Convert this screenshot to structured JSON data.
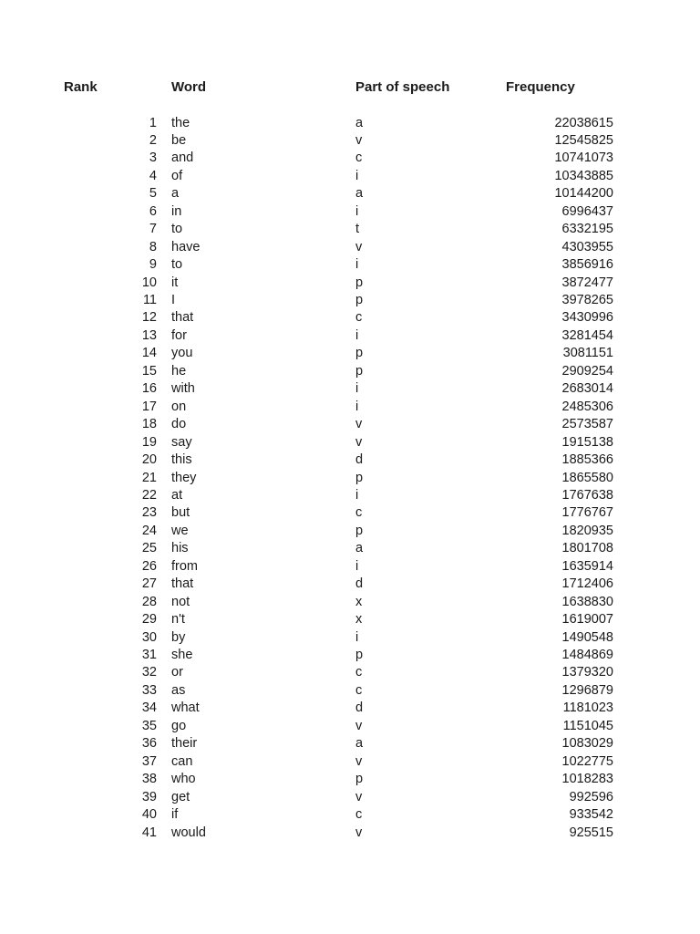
{
  "headers": {
    "rank": "Rank",
    "word": "Word",
    "pos": "Part of speech",
    "frequency": "Frequency"
  },
  "rows": [
    [
      "1",
      "the",
      "a",
      "22038615"
    ],
    [
      "2",
      "be",
      "v",
      "12545825"
    ],
    [
      "3",
      "and",
      "c",
      "10741073"
    ],
    [
      "4",
      "of",
      "i",
      "10343885"
    ],
    [
      "5",
      "a",
      "a",
      "10144200"
    ],
    [
      "6",
      "in",
      "i",
      "6996437"
    ],
    [
      "7",
      "to",
      "t",
      "6332195"
    ],
    [
      "8",
      "have",
      "v",
      "4303955"
    ],
    [
      "9",
      "to",
      "i",
      "3856916"
    ],
    [
      "10",
      "it",
      "p",
      "3872477"
    ],
    [
      "11",
      "I",
      "p",
      "3978265"
    ],
    [
      "12",
      "that",
      "c",
      "3430996"
    ],
    [
      "13",
      "for",
      "i",
      "3281454"
    ],
    [
      "14",
      "you",
      "p",
      "3081151"
    ],
    [
      "15",
      "he",
      "p",
      "2909254"
    ],
    [
      "16",
      "with",
      "i",
      "2683014"
    ],
    [
      "17",
      "on",
      "i",
      "2485306"
    ],
    [
      "18",
      "do",
      "v",
      "2573587"
    ],
    [
      "19",
      "say",
      "v",
      "1915138"
    ],
    [
      "20",
      "this",
      "d",
      "1885366"
    ],
    [
      "21",
      "they",
      "p",
      "1865580"
    ],
    [
      "22",
      "at",
      "i",
      "1767638"
    ],
    [
      "23",
      "but",
      "c",
      "1776767"
    ],
    [
      "24",
      "we",
      "p",
      "1820935"
    ],
    [
      "25",
      "his",
      "a",
      "1801708"
    ],
    [
      "26",
      "from",
      "i",
      "1635914"
    ],
    [
      "27",
      "that",
      "d",
      "1712406"
    ],
    [
      "28",
      "not",
      "x",
      "1638830"
    ],
    [
      "29",
      "n't",
      "x",
      "1619007"
    ],
    [
      "30",
      "by",
      "i",
      "1490548"
    ],
    [
      "31",
      "she",
      "p",
      "1484869"
    ],
    [
      "32",
      "or",
      "c",
      "1379320"
    ],
    [
      "33",
      "as",
      "c",
      "1296879"
    ],
    [
      "34",
      "what",
      "d",
      "1181023"
    ],
    [
      "35",
      "go",
      "v",
      "1151045"
    ],
    [
      "36",
      "their",
      "a",
      "1083029"
    ],
    [
      "37",
      "can",
      "v",
      "1022775"
    ],
    [
      "38",
      "who",
      "p",
      "1018283"
    ],
    [
      "39",
      "get",
      "v",
      "992596"
    ],
    [
      "40",
      "if",
      "c",
      "933542"
    ],
    [
      "41",
      "would",
      "v",
      "925515"
    ]
  ]
}
